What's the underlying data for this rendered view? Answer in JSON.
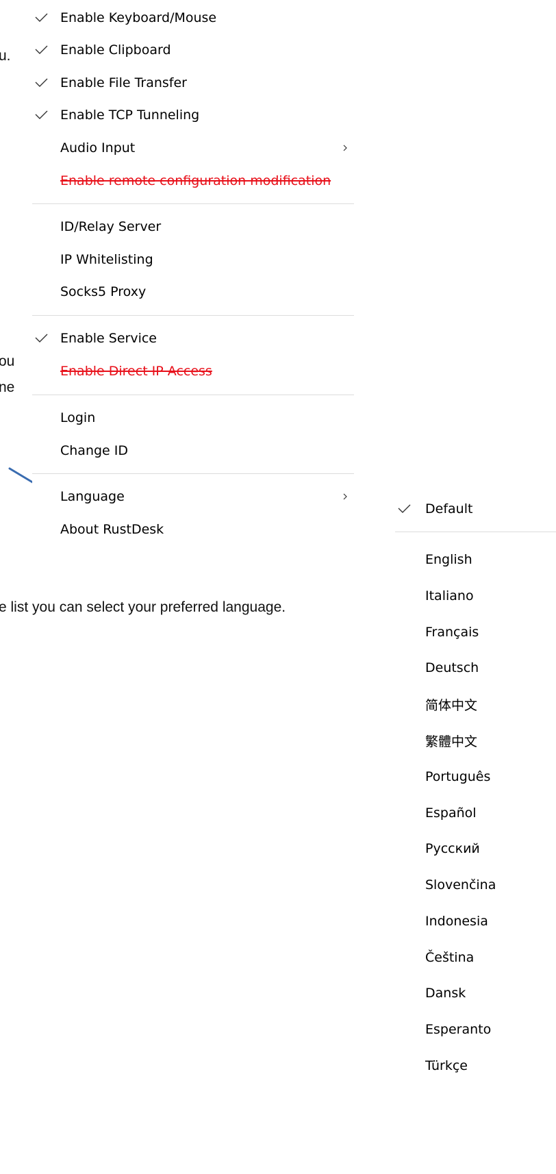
{
  "background_text": {
    "fragment_1": "u.",
    "fragment_2": "ou",
    "fragment_3": "ne",
    "fragment_4": "e list you can select your preferred language."
  },
  "main_menu": {
    "items": [
      {
        "label": "Enable Keyboard/Mouse",
        "checked": true
      },
      {
        "label": "Enable Clipboard",
        "checked": true
      },
      {
        "label": "Enable File Transfer",
        "checked": true
      },
      {
        "label": "Enable TCP Tunneling",
        "checked": true
      },
      {
        "label": "Audio Input",
        "submenu": true
      },
      {
        "label": "Enable remote configuration modification",
        "disabled_style": "strikethrough-red"
      },
      {
        "label": "ID/Relay Server"
      },
      {
        "label": "IP Whitelisting"
      },
      {
        "label": "Socks5 Proxy"
      },
      {
        "label": "Enable Service",
        "checked": true
      },
      {
        "label": "Enable Direct IP Access",
        "disabled_style": "strikethrough-red"
      },
      {
        "label": "Login"
      },
      {
        "label": "Change ID"
      },
      {
        "label": "Language",
        "submenu": true
      },
      {
        "label": "About RustDesk"
      }
    ]
  },
  "language_menu": {
    "items": [
      {
        "label": "Default",
        "checked": true
      },
      {
        "label": "English"
      },
      {
        "label": "Italiano"
      },
      {
        "label": "Français"
      },
      {
        "label": "Deutsch"
      },
      {
        "label": "简体中文"
      },
      {
        "label": "繁體中文"
      },
      {
        "label": "Português"
      },
      {
        "label": "Español"
      },
      {
        "label": "Русский"
      },
      {
        "label": "Slovenčina"
      },
      {
        "label": "Indonesia"
      },
      {
        "label": "Čeština"
      },
      {
        "label": "Dansk"
      },
      {
        "label": "Esperanto"
      },
      {
        "label": "Türkçe"
      }
    ]
  },
  "colors": {
    "strikethrough_text": "#e8101a",
    "pointer_arrow": "#3a6cb0",
    "separator": "#dcdcdc"
  },
  "icons": {
    "check": "check-icon",
    "submenu": "chevron-right-icon",
    "pointer": "arrow-pointer-icon"
  }
}
